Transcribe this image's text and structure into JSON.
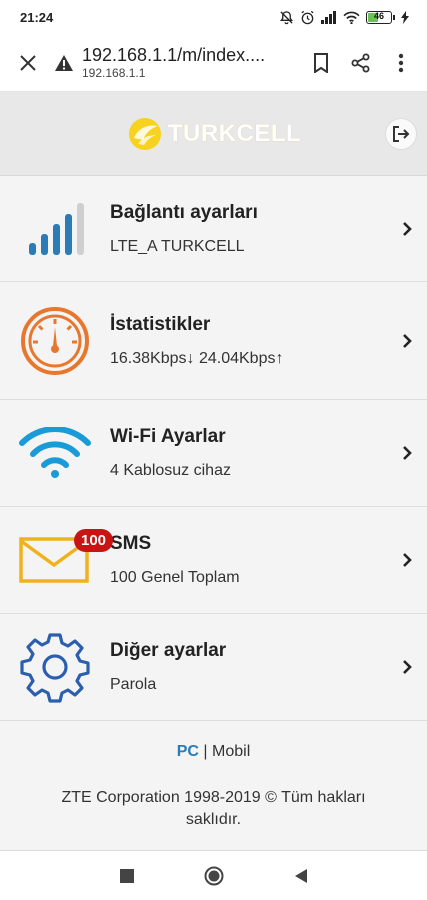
{
  "status_bar": {
    "time": "21:24",
    "battery_percent": "46"
  },
  "browser": {
    "url": "192.168.1.1/m/index....",
    "url_host": "192.168.1.1"
  },
  "header": {
    "brand": "TURKCELL"
  },
  "menu": [
    {
      "title": "Bağlantı ayarları",
      "subtitle": "LTE_A  TURKCELL",
      "icon": "signal-bars-icon"
    },
    {
      "title": "İstatistikler",
      "subtitle": "16.38Kbps↓ 24.04Kbps↑",
      "icon": "speedometer-icon"
    },
    {
      "title": "Wi-Fi Ayarlar",
      "subtitle": "4 Kablosuz cihaz",
      "icon": "wifi-icon"
    },
    {
      "title": "SMS",
      "subtitle": "100 Genel Toplam",
      "icon": "envelope-icon",
      "badge": "100"
    },
    {
      "title": "Diğer ayarlar",
      "subtitle": "Parola",
      "icon": "gear-icon"
    }
  ],
  "footer": {
    "pc_label": "PC",
    "separator": "|",
    "mobile_label": "Mobil",
    "copyright": "ZTE Corporation 1998-2019 © Tüm hakları saklıdır."
  },
  "colors": {
    "accent": "#2a7bb6",
    "badge": "#c91414",
    "orange": "#e8772e",
    "sms_yellow": "#f0b21c",
    "gear_blue": "#2b5fae"
  }
}
